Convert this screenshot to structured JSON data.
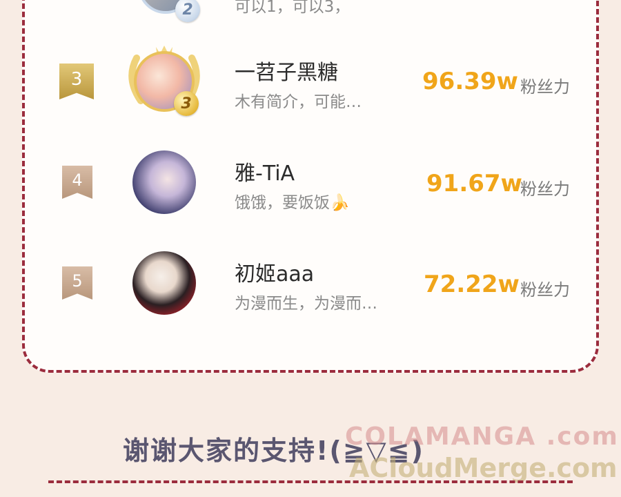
{
  "top_row": {
    "bio": "可以1，可以3，",
    "medal": "2"
  },
  "rows": [
    {
      "rank": "3",
      "medal": "3",
      "name": "一苕子黑糖",
      "bio": "木有简介，可能…",
      "score": "96.39w",
      "score_label": "粉丝力"
    },
    {
      "rank": "4",
      "name": "雅-TiA",
      "bio": "饿饿，要饭饭🍌",
      "score": "91.67w",
      "score_label": "粉丝力"
    },
    {
      "rank": "5",
      "name": "初姬aaa",
      "bio": "为漫而生，为漫而…",
      "score": "72.22w",
      "score_label": "粉丝力"
    }
  ],
  "footer": {
    "thanks": "谢谢大家的支持!(≧▽≦)"
  },
  "watermark": {
    "line1": "COLAMANGA .com",
    "line2": "ACloudMerge.com"
  },
  "colors": {
    "accent": "#f0a51a",
    "border": "#9b2c3d",
    "background": "#f8ece4",
    "rank3": "#d4b25a",
    "rank_other": "#c9aa92"
  }
}
